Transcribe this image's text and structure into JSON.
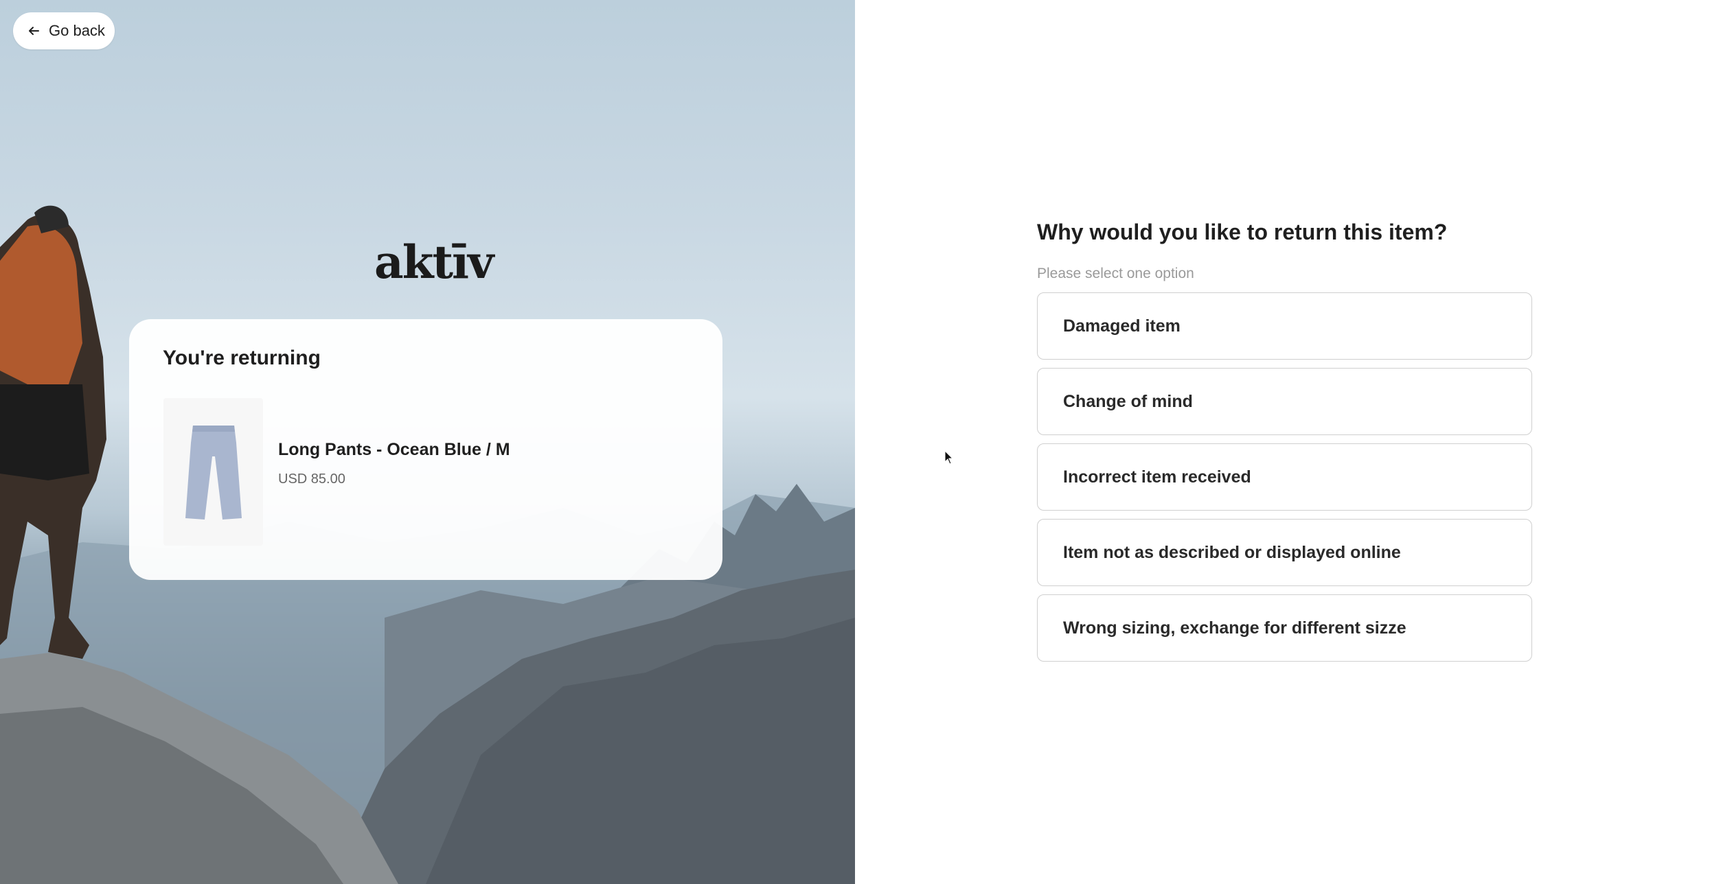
{
  "back_button": {
    "label": "Go back",
    "icon": "arrow-left-icon"
  },
  "brand": {
    "logo_text": "aktīv"
  },
  "return_card": {
    "heading": "You're returning",
    "product": {
      "name": "Long Pants - Ocean Blue / M",
      "price": "USD 85.00",
      "image": "pants-image"
    }
  },
  "reason_form": {
    "question": "Why would you like to return this item?",
    "hint": "Please select one option",
    "options": [
      "Damaged item",
      "Change of mind",
      "Incorrect item received",
      "Item not as described or displayed online",
      "Wrong sizing, exchange for different sizze"
    ]
  },
  "colors": {
    "text": "#1f1f1f",
    "hint": "#9a9a9a",
    "option_border": "#cfcfcf",
    "pants": "#a9b6cf"
  }
}
